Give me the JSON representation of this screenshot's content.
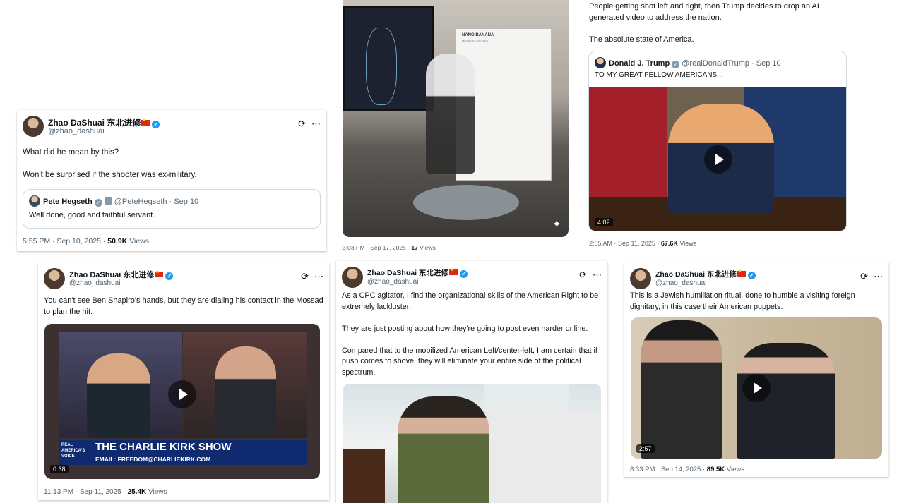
{
  "icons": {
    "grok": "⟳",
    "more": "⋯",
    "verified": "✓",
    "play": "play-icon",
    "sparkle": "✦"
  },
  "tweet1": {
    "name": "Zhao DaShuai 东北进修",
    "handle": "@zhao_dashuai",
    "text": "What did he mean by this?\n\nWon't be surprised if the shooter was ex-military.",
    "quote": {
      "name": "Pete Hegseth",
      "handle": "@PeteHegseth",
      "date": "Sep 10",
      "text": "Well done, good and faithful servant."
    },
    "time": "5:55 PM · Sep 10, 2025 · ",
    "views_count": "50.9K",
    "views_label": " Views"
  },
  "tweet2": {
    "image_label": "NANO BANANA",
    "image_sublabel": "MODEL KIT SERIES",
    "time": "3:03 PM · Sep 17, 2025 · ",
    "views_count": "17",
    "views_label": " Views"
  },
  "tweet3": {
    "text": "People getting shot left and right, then Trump decides to drop an AI generated video to address the nation.\n\nThe absolute state of America.",
    "quote": {
      "name": "Donald J. Trump",
      "handle": "@realDonaldTrump",
      "date": "Sep 10",
      "text": "TO MY GREAT FELLOW AMERICANS..."
    },
    "duration": "4:02",
    "time": "2:05 AM · Sep 11, 2025 · ",
    "views_count": "67.6K",
    "views_label": " Views"
  },
  "tweet4": {
    "name": "Zhao DaShuai 东北进修",
    "handle": "@zhao_dashuai",
    "text": "You can't see Ben Shapiro's hands, but they are dialing his contact in the Mossad to plan the hit.",
    "show_title": "THE CHARLIE KIRK SHOW",
    "show_email": "EMAIL: FREEDOM@CHARLIEKIRK.COM",
    "show_logo": "REAL AMERICA'S VOICE",
    "duration": "0:38",
    "time": "11:13 PM · Sep 11, 2025 · ",
    "views_count": "25.4K",
    "views_label": " Views"
  },
  "tweet5": {
    "name": "Zhao DaShuai 东北进修",
    "handle": "@zhao_dashuai",
    "text": "As a CPC agitator, I find the organizational skills of the American Right to be extremely lackluster.\n\nThey are just posting about how they're going to post even harder online.\n\nCompared that to the mobilized American Left/center-left, I am certain that if push comes to shove, they will eliminate your entire side of the political spectrum."
  },
  "tweet6": {
    "name": "Zhao DaShuai 东北进修",
    "handle": "@zhao_dashuai",
    "text": "This is a Jewish humiliation ritual, done to humble a visiting foreign dignitary, in this case their American puppets.",
    "duration": "2:57",
    "time": "8:33 PM · Sep 14, 2025 · ",
    "views_count": "89.5K",
    "views_label": " Views"
  }
}
